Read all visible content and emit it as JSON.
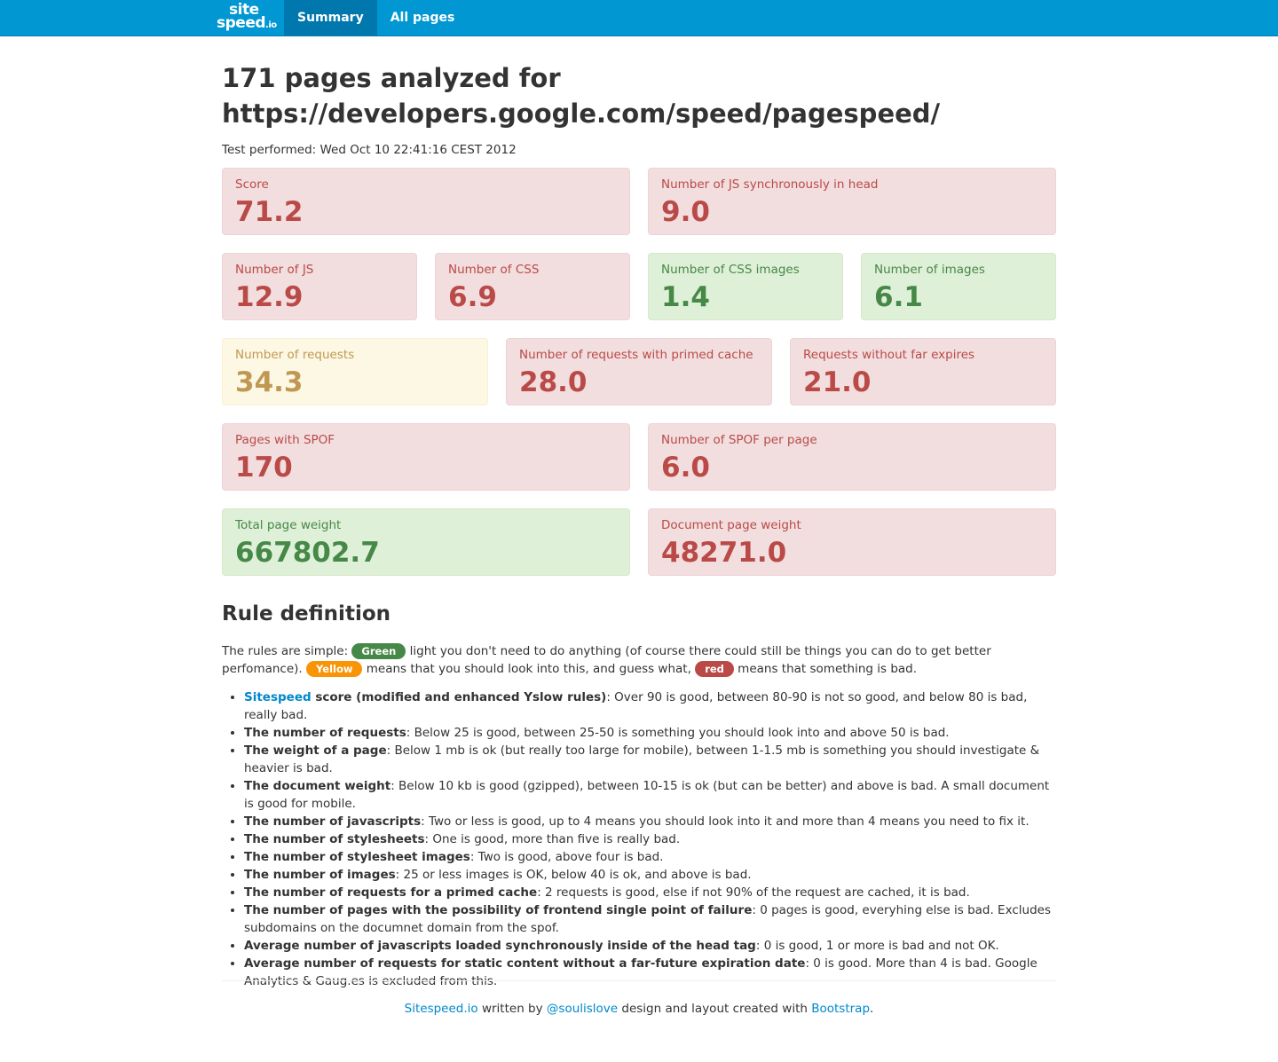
{
  "nav": {
    "brand_line1": "site",
    "brand_line2": "speed",
    "brand_suffix": ".io",
    "items": [
      {
        "label": "Summary",
        "active": true
      },
      {
        "label": "All pages",
        "active": false
      }
    ]
  },
  "header": {
    "title_line1": "171 pages analyzed for",
    "title_line2": "https://developers.google.com/speed/pagespeed/",
    "test_performed": "Test performed: Wed Oct 10 22:41:16 CEST 2012"
  },
  "metrics": [
    {
      "label": "Score",
      "value": "71.2",
      "status": "red"
    },
    {
      "label": "Number of JS synchronously in head",
      "value": "9.0",
      "status": "red"
    },
    {
      "label": "Number of JS",
      "value": "12.9",
      "status": "red"
    },
    {
      "label": "Number of CSS",
      "value": "6.9",
      "status": "red"
    },
    {
      "label": "Number of CSS images",
      "value": "1.4",
      "status": "green"
    },
    {
      "label": "Number of images",
      "value": "6.1",
      "status": "green"
    },
    {
      "label": "Number of requests",
      "value": "34.3",
      "status": "yellow"
    },
    {
      "label": "Number of requests with primed cache",
      "value": "28.0",
      "status": "red"
    },
    {
      "label": "Requests without far expires",
      "value": "21.0",
      "status": "red"
    },
    {
      "label": "Pages with SPOF",
      "value": "170",
      "status": "red"
    },
    {
      "label": "Number of SPOF per page",
      "value": "6.0",
      "status": "red"
    },
    {
      "label": "Total page weight",
      "value": "667802.7",
      "status": "green"
    },
    {
      "label": "Document page weight",
      "value": "48271.0",
      "status": "red"
    }
  ],
  "rules": {
    "title": "Rule definition",
    "intro_1": "The rules are simple: ",
    "badge_green": "Green",
    "intro_2": " light you don't need to do anything (of course there could still be things you can do to get better perfomance). ",
    "badge_yellow": "Yellow",
    "intro_3": " means that you should look into this, and guess what, ",
    "badge_red": "red",
    "intro_4": " means that something is bad.",
    "first_link": "Sitespeed",
    "first_bold": " score (modified and enhanced Yslow rules)",
    "first_text": ": Over 90 is good, between 80-90 is not so good, and below 80 is bad, really bad.",
    "items": [
      {
        "bold": "The number of requests",
        "text": ": Below 25 is good, between 25-50 is something you should look into and above 50 is bad."
      },
      {
        "bold": "The weight of a page",
        "text": ": Below 1 mb is ok (but really too large for mobile), between 1-1.5 mb is something you should investigate & heavier is bad."
      },
      {
        "bold": "The document weight",
        "text": ": Below 10 kb is good (gzipped), between 10-15 is ok (but can be better) and above is bad. A small document is good for mobile."
      },
      {
        "bold": "The number of javascripts",
        "text": ": Two or less is good, up to 4 means you should look into it and more than 4 means you need to fix it."
      },
      {
        "bold": "The number of stylesheets",
        "text": ": One is good, more than five is really bad."
      },
      {
        "bold": "The number of stylesheet images",
        "text": ": Two is good, above four is bad."
      },
      {
        "bold": "The number of images",
        "text": ": 25 or less images is OK, below 40 is ok, and above is bad."
      },
      {
        "bold": "The number of requests for a primed cache",
        "text": ": 2 requests is good, else if not 90% of the request are cached, it is bad."
      },
      {
        "bold": "The number of pages with the possibility of frontend single point of failure",
        "text": ": 0 pages is good, everyhing else is bad. Excludes subdomains on the documnet domain from the spof."
      },
      {
        "bold": "Average number of javascripts loaded synchronously inside of the head tag",
        "text": ": 0 is good, 1 or more is bad and not OK."
      },
      {
        "bold": "Average number of requests for static content without a far-future expiration date",
        "text": ": 0 is good. More than 4 is bad. Google Analytics & Gaug.es is excluded from this."
      }
    ]
  },
  "footer": {
    "link1": "Sitespeed.io",
    "text1": " written by ",
    "link2": "@soulislove",
    "text2": " design and layout created with ",
    "link3": "Bootstrap",
    "text3": "."
  }
}
